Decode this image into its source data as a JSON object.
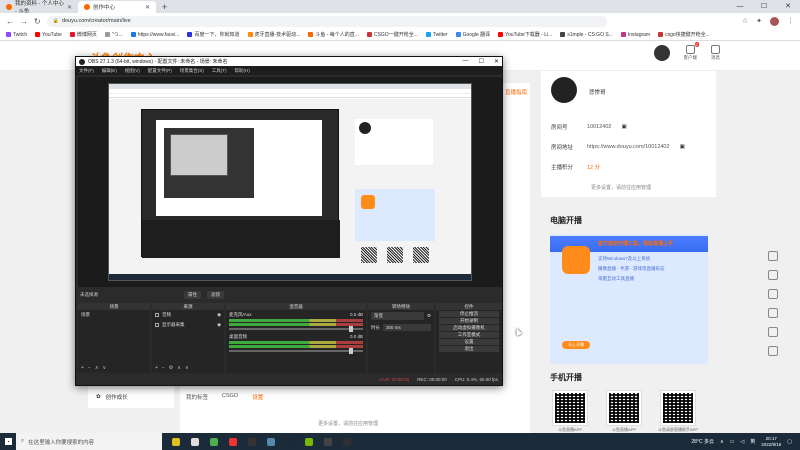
{
  "browser": {
    "tabs": [
      {
        "label": "我的资料 - 个人中心 - 斗鱼",
        "active": false
      },
      {
        "label": "创作中心",
        "active": true
      }
    ],
    "new_tab": "+",
    "window_buttons": [
      "—",
      "☐",
      "✕"
    ],
    "url": "douyu.com/creator/main/live",
    "bookmarks": [
      "Twitch",
      "YouTube",
      "微博网页",
      "\"つ...",
      "https://www.facei...",
      "百度一下，你就知道",
      "虎牙直播-技术驱动...",
      "斗鱼 - 每个人的直...",
      "CSGO一键开枪全...",
      "Twitter",
      "Google 翻译",
      "YouTube下载器 - Li...",
      "s1mple - CS:GO S...",
      "Instagram",
      "csgo快捷键开枪全..."
    ]
  },
  "douyu": {
    "logo": "斗鱼创作中心",
    "header": {
      "live_label": "客户端",
      "live_badge": "2",
      "msg_label": "消息"
    },
    "live_link": "直播指南",
    "left_menu": {
      "label": "创作成长"
    },
    "bottom_tabs": [
      "我的标签",
      "CSGO",
      "设置"
    ],
    "more_settings": "更多设置，请前往应用管理",
    "profile": {
      "name": "悲惨哥",
      "room_label": "房间号",
      "room_value": "10012402",
      "addr_label": "房间地址",
      "addr_value": "https://www.douyu.com/10012402",
      "points_label": "主播积分",
      "points_value": "12 分",
      "more": "更多设置，请前往应用管理"
    },
    "pc_section": {
      "title": "电脑开播",
      "banner_lines": [
        "官方指定开播工具，轻松直播上手",
        "支持Windows7及以上系统",
        "摄像直播 · 手游 · 游戏等直播形态",
        "海量互动工具直播"
      ],
      "banner_button": "马上开播"
    },
    "mobile_section": {
      "title": "手机开播",
      "apps": [
        {
          "name": "斗鱼直播APP",
          "os": "iOS"
        },
        {
          "name": "斗鱼直播APP",
          "os": "安卓"
        },
        {
          "name": "斗鱼录屏直播助手APP",
          "os": "iOS"
        }
      ]
    }
  },
  "obs": {
    "title": "OBS 27.1.3 (64-bit, windows) - 配置文件: 未命名 - 场景: 未命名",
    "menus": [
      "文件(F)",
      "编辑(E)",
      "视图(V)",
      "配置文件(P)",
      "场景集合(S)",
      "工具(T)",
      "帮助(H)"
    ],
    "no_source": "未选择源",
    "props_btn": "属性",
    "filters_btn": "滤镜",
    "docks": {
      "scenes": {
        "title": "场景",
        "items": [
          "场景"
        ]
      },
      "sources": {
        "title": "来源",
        "items": [
          "音频",
          "显示器采集"
        ]
      },
      "mixer": {
        "title": "混音器",
        "tracks": [
          {
            "name": "麦克风/Aux",
            "db": "0.0 dB"
          },
          {
            "name": "桌面音频",
            "db": "0.0 dB"
          }
        ]
      },
      "transitions": {
        "title": "转场特效",
        "mode": "渐变",
        "duration_label": "时长",
        "duration_value": "300 ms"
      },
      "controls": {
        "title": "控件",
        "buttons": [
          "停止推流",
          "开始录制",
          "启动虚拟摄像机",
          "工作室模式",
          "设置",
          "退出"
        ]
      }
    },
    "status": {
      "live": "LIVE: 00:00:00",
      "rec": "REC: 00:00:00",
      "cpu": "CPU: 0.4%, 60.00 fps"
    }
  },
  "taskbar": {
    "search_placeholder": "在这里输入你要搜索的内容",
    "weather": "28°C 多云",
    "time": "20:17",
    "date": "2022/9/16",
    "lang": "英"
  }
}
